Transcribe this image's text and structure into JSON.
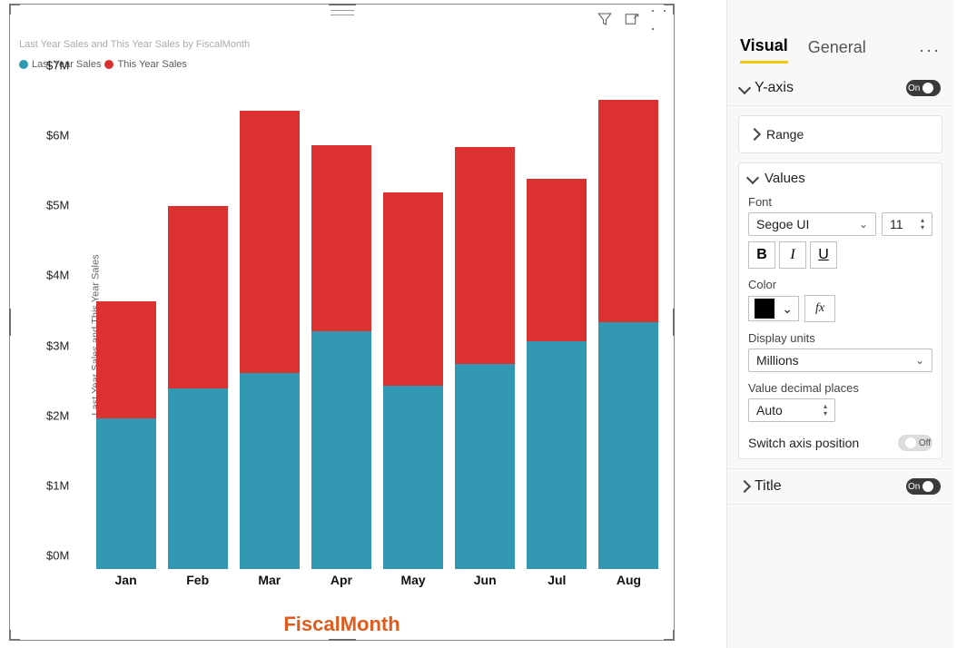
{
  "chart_data": {
    "type": "bar",
    "stacked": true,
    "title": "Last Year Sales and This Year Sales by FiscalMonth",
    "xlabel": "FiscalMonth",
    "ylabel": "Last Year Sales and This Year Sales",
    "ylim": [
      0,
      7000000
    ],
    "y_ticks": [
      "$0M",
      "$1M",
      "$2M",
      "$3M",
      "$4M",
      "$5M",
      "$6M",
      "$7M"
    ],
    "categories": [
      "Jan",
      "Feb",
      "Mar",
      "Apr",
      "May",
      "Jun",
      "Jul",
      "Aug"
    ],
    "series": [
      {
        "name": "Last Year Sales",
        "color": "#3298b1",
        "values": [
          2150000,
          2580000,
          2800000,
          3400000,
          2620000,
          2930000,
          3260000,
          3520000
        ]
      },
      {
        "name": "This Year Sales",
        "color": "#db3131",
        "values": [
          1680000,
          2600000,
          3750000,
          2650000,
          2760000,
          3100000,
          2320000,
          3180000
        ]
      }
    ],
    "legend": [
      "Last Year Sales",
      "This Year Sales"
    ]
  },
  "pane": {
    "tabs": {
      "visual": "Visual",
      "general": "General"
    },
    "yaxis": {
      "label": "Y-axis",
      "toggle": "On"
    },
    "range_label": "Range",
    "values": {
      "label": "Values",
      "font_label": "Font",
      "font_family": "Segoe UI",
      "font_size": "11",
      "color_label": "Color",
      "display_units_label": "Display units",
      "display_units_value": "Millions",
      "decimal_label": "Value decimal places",
      "decimal_value": "Auto",
      "switch_label": "Switch axis position",
      "switch_state": "Off"
    },
    "title_label": "Title"
  }
}
